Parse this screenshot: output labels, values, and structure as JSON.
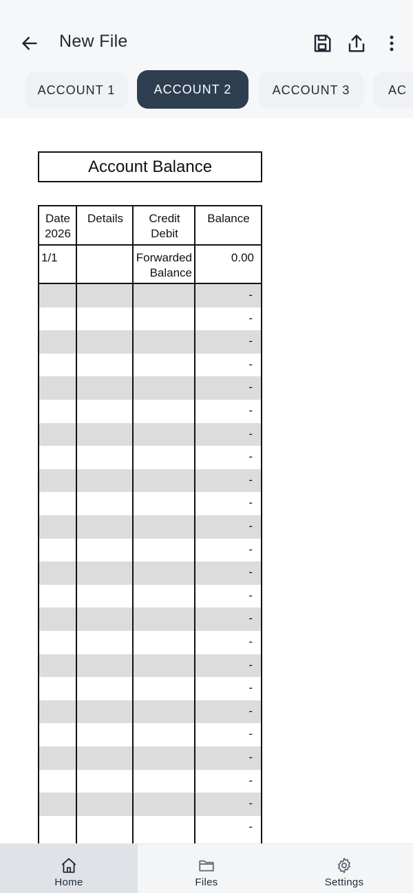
{
  "header": {
    "title": "New File",
    "back_icon": "arrow-left-icon",
    "actions": [
      "save-icon",
      "share-icon",
      "more-vertical-icon"
    ]
  },
  "tabs": [
    {
      "label": "ACCOUNT 1",
      "active": false
    },
    {
      "label": "ACCOUNT 2",
      "active": true
    },
    {
      "label": "ACCOUNT 3",
      "active": false
    },
    {
      "label": "AC",
      "active": false
    }
  ],
  "sheet": {
    "title": "Account Balance",
    "columns": {
      "date_line1": "Date",
      "date_line2": "2026",
      "details": "Details",
      "credit_line1": "Credit",
      "credit_line2": "Debit",
      "balance": "Balance"
    },
    "opening_row": {
      "date": "1/1",
      "detail_line1": "Forwarded",
      "detail_line2": "Balance",
      "balance": "0.00"
    },
    "empty_balance": "-",
    "empty_row_count": 24
  },
  "bottom_nav": [
    {
      "label": "Home",
      "icon": "home-icon",
      "active": true
    },
    {
      "label": "Files",
      "icon": "folder-icon",
      "active": false
    },
    {
      "label": "Settings",
      "icon": "gear-icon",
      "active": false
    }
  ],
  "colors": {
    "accent": "#2e3e51",
    "header_bg": "#f6f7f9",
    "stripe": "#dcdcdc"
  }
}
